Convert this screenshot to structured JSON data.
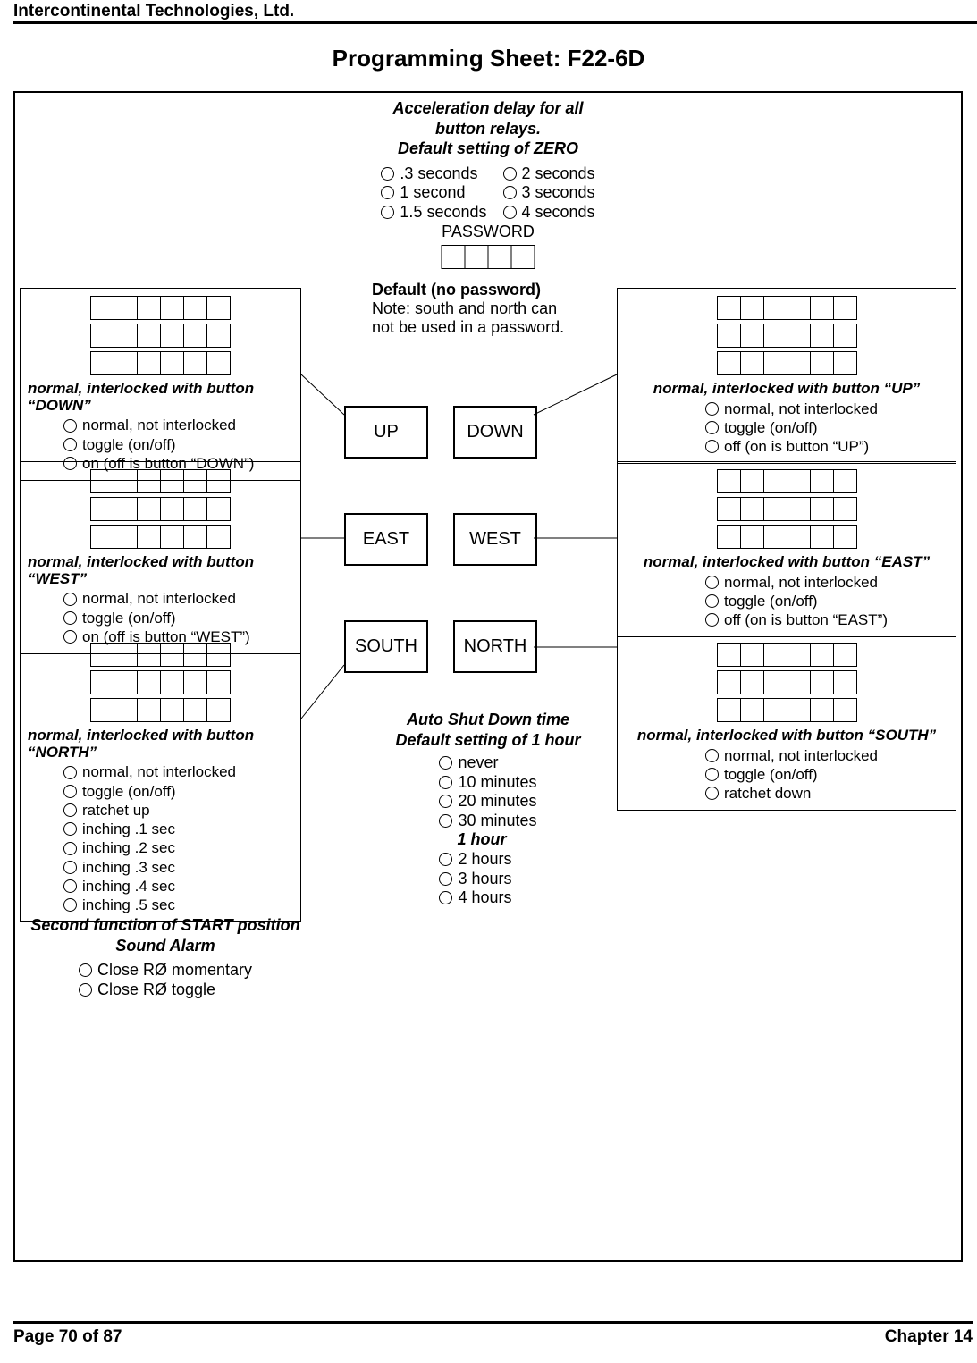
{
  "company": "Intercontinental Technologies, Ltd.",
  "title": "Programming Sheet:  F22-6D",
  "footer": {
    "page": "Page 70 of 87",
    "chapter": "Chapter 14"
  },
  "accel": {
    "line1": "Acceleration delay for all",
    "line2": "button relays.",
    "line3": "Default setting of ZERO",
    "left": [
      ".3 seconds",
      "1 second",
      "1.5 seconds"
    ],
    "right": [
      "2 seconds",
      "3 seconds",
      "4 seconds"
    ]
  },
  "password": {
    "label": "PASSWORD",
    "default": "Default (no password)",
    "note1": "Note: south and north can",
    "note2": "not be used in a password."
  },
  "buttons": {
    "up": "UP",
    "down": "DOWN",
    "east": "EAST",
    "west": "WEST",
    "south": "SOUTH",
    "north": "NORTH"
  },
  "panel_up": {
    "title": "normal, interlocked with button “DOWN”",
    "opts": [
      "normal, not interlocked",
      "toggle (on/off)",
      "on (off is button “DOWN”)"
    ]
  },
  "panel_down": {
    "title": "normal, interlocked with button “UP”",
    "opts": [
      "normal, not interlocked",
      "toggle (on/off)",
      "off (on is button “UP”)"
    ]
  },
  "panel_east": {
    "title": "normal, interlocked with button “WEST”",
    "opts": [
      "normal, not interlocked",
      "toggle (on/off)",
      "on (off is button “WEST”)"
    ]
  },
  "panel_west": {
    "title": "normal, interlocked with button “EAST”",
    "opts": [
      "normal, not interlocked",
      "toggle (on/off)",
      "off (on is button “EAST”)"
    ]
  },
  "panel_south": {
    "title": "normal, interlocked with button “NORTH”",
    "opts": [
      "normal, not interlocked",
      "toggle (on/off)",
      "ratchet up",
      "inching .1 sec",
      "inching .2 sec",
      "inching .3 sec",
      "inching .4 sec",
      "inching .5 sec"
    ]
  },
  "panel_north": {
    "title": "normal, interlocked with button “SOUTH”",
    "opts": [
      "normal, not interlocked",
      "toggle (on/off)",
      "ratchet down"
    ]
  },
  "asd": {
    "title1": "Auto Shut Down time",
    "title2": "Default setting of 1 hour",
    "opts": [
      "never",
      "10 minutes",
      "20 minutes",
      "30 minutes",
      "1 hour",
      "2 hours",
      "3 hours",
      "4 hours"
    ],
    "bold_index": 4
  },
  "second_fn": {
    "title1": "Second function of START position",
    "title2": "Sound Alarm",
    "opts": [
      "Close RØ momentary",
      "Close RØ toggle"
    ]
  }
}
